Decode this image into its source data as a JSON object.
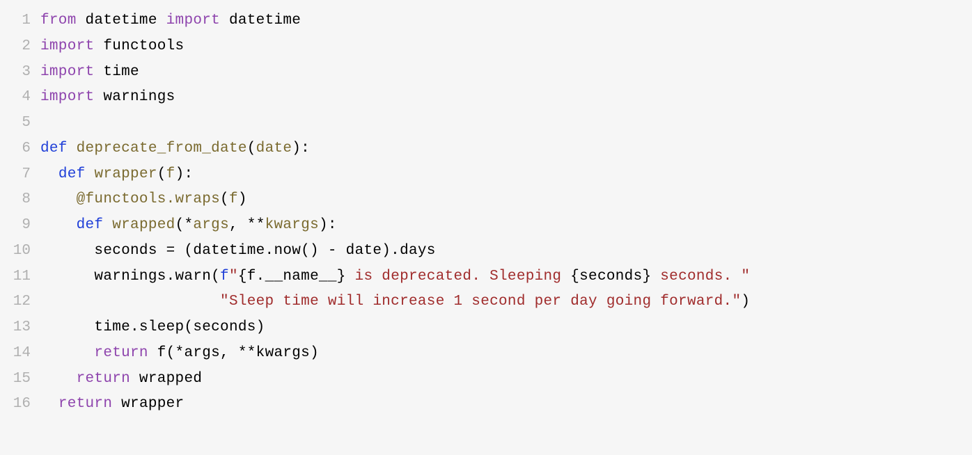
{
  "lines": [
    {
      "n": "1",
      "tokens": [
        [
          "kw-import",
          "from"
        ],
        [
          "txt",
          " datetime "
        ],
        [
          "kw-import",
          "import"
        ],
        [
          "txt",
          " datetime"
        ]
      ]
    },
    {
      "n": "2",
      "tokens": [
        [
          "kw-import",
          "import"
        ],
        [
          "txt",
          " functools"
        ]
      ]
    },
    {
      "n": "3",
      "tokens": [
        [
          "kw-import",
          "import"
        ],
        [
          "txt",
          " time"
        ]
      ]
    },
    {
      "n": "4",
      "tokens": [
        [
          "kw-import",
          "import"
        ],
        [
          "txt",
          " warnings"
        ]
      ]
    },
    {
      "n": "5",
      "tokens": []
    },
    {
      "n": "6",
      "tokens": [
        [
          "kw-def",
          "def"
        ],
        [
          "txt",
          " "
        ],
        [
          "fn-name",
          "deprecate_from_date"
        ],
        [
          "txt",
          "("
        ],
        [
          "param",
          "date"
        ],
        [
          "txt",
          "):"
        ]
      ]
    },
    {
      "n": "7",
      "tokens": [
        [
          "txt",
          "  "
        ],
        [
          "kw-def",
          "def"
        ],
        [
          "txt",
          " "
        ],
        [
          "fn-name",
          "wrapper"
        ],
        [
          "txt",
          "("
        ],
        [
          "param",
          "f"
        ],
        [
          "txt",
          "):"
        ]
      ]
    },
    {
      "n": "8",
      "tokens": [
        [
          "txt",
          "    "
        ],
        [
          "deco",
          "@functools.wraps"
        ],
        [
          "txt",
          "("
        ],
        [
          "param",
          "f"
        ],
        [
          "txt",
          ")"
        ]
      ]
    },
    {
      "n": "9",
      "tokens": [
        [
          "txt",
          "    "
        ],
        [
          "kw-def",
          "def"
        ],
        [
          "txt",
          " "
        ],
        [
          "fn-name",
          "wrapped"
        ],
        [
          "txt",
          "(*"
        ],
        [
          "param",
          "args"
        ],
        [
          "txt",
          ", **"
        ],
        [
          "param",
          "kwargs"
        ],
        [
          "txt",
          "):"
        ]
      ]
    },
    {
      "n": "10",
      "tokens": [
        [
          "txt",
          "      seconds = (datetime.now() - date).days"
        ]
      ]
    },
    {
      "n": "11",
      "tokens": [
        [
          "txt",
          "      warnings.warn("
        ],
        [
          "fstr-pf",
          "f"
        ],
        [
          "str",
          "\""
        ],
        [
          "fexpr",
          "{f.__name__}"
        ],
        [
          "str",
          " is deprecated. Sleeping "
        ],
        [
          "fexpr",
          "{seconds}"
        ],
        [
          "str",
          " seconds. \""
        ]
      ]
    },
    {
      "n": "12",
      "tokens": [
        [
          "txt",
          "                    "
        ],
        [
          "str",
          "\"Sleep time will increase 1 second per day going forward.\""
        ],
        [
          "txt",
          ")"
        ]
      ]
    },
    {
      "n": "13",
      "tokens": [
        [
          "txt",
          "      time.sleep(seconds)"
        ]
      ]
    },
    {
      "n": "14",
      "tokens": [
        [
          "txt",
          "      "
        ],
        [
          "kw-import",
          "return"
        ],
        [
          "txt",
          " f(*args, **kwargs)"
        ]
      ]
    },
    {
      "n": "15",
      "tokens": [
        [
          "txt",
          "    "
        ],
        [
          "kw-import",
          "return"
        ],
        [
          "txt",
          " wrapped"
        ]
      ]
    },
    {
      "n": "16",
      "tokens": [
        [
          "txt",
          "  "
        ],
        [
          "kw-import",
          "return"
        ],
        [
          "txt",
          " wrapper"
        ]
      ]
    }
  ]
}
